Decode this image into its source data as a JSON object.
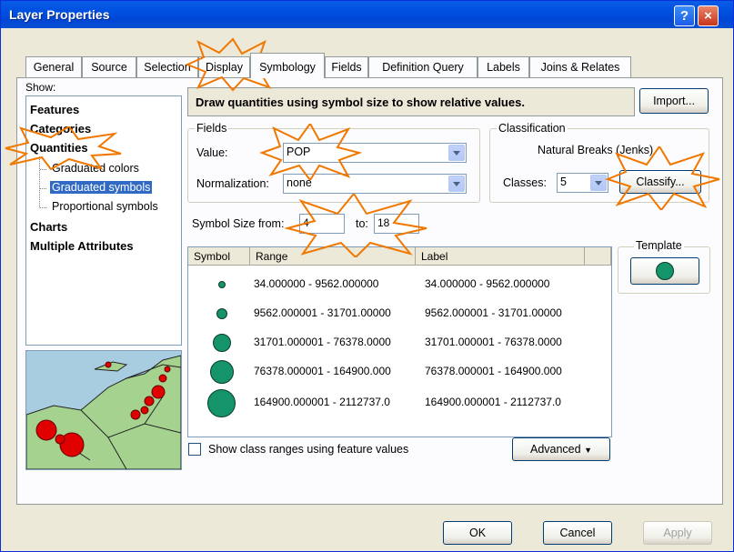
{
  "window": {
    "title": "Layer Properties",
    "help_label": "?",
    "close_label": "×"
  },
  "tabs": [
    "General",
    "Source",
    "Selection",
    "Display",
    "Symbology",
    "Fields",
    "Definition Query",
    "Labels",
    "Joins & Relates"
  ],
  "active_tab": "Symbology",
  "show": {
    "label": "Show:",
    "items": [
      "Features",
      "Categories",
      "Quantities",
      "Graduated colors",
      "Graduated symbols",
      "Proportional symbols",
      "Charts",
      "Multiple Attributes"
    ],
    "selected": "Graduated symbols"
  },
  "description": "Draw quantities using symbol size to show relative values.",
  "import_label": "Import...",
  "fields": {
    "group_label": "Fields",
    "value_label": "Value:",
    "value": "POP",
    "normalization_label": "Normalization:",
    "normalization": "none"
  },
  "classification": {
    "group_label": "Classification",
    "method": "Natural Breaks (Jenks)",
    "classes_label": "Classes:",
    "classes": "5",
    "classify_label": "Classify..."
  },
  "symbol_size": {
    "from_label": "Symbol Size from:",
    "from": "4",
    "to_label": "to:",
    "to": "18"
  },
  "table": {
    "headers": [
      "Symbol",
      "Range",
      "Label"
    ],
    "rows": [
      {
        "range": "34.000000 - 9562.000000",
        "label": "34.000000 - 9562.000000"
      },
      {
        "range": "9562.000001 - 31701.00000",
        "label": "9562.000001 - 31701.00000"
      },
      {
        "range": "31701.000001 - 76378.0000",
        "label": "31701.000001 - 76378.0000"
      },
      {
        "range": "76378.000001 - 164900.000",
        "label": "76378.000001 - 164900.000"
      },
      {
        "range": "164900.000001 - 2112737.0",
        "label": "164900.000001 - 2112737.0"
      }
    ]
  },
  "template_label": "Template",
  "show_ranges_label": "Show class ranges using feature values",
  "advanced_label": "Advanced",
  "buttons": {
    "ok": "OK",
    "cancel": "Cancel",
    "apply": "Apply"
  },
  "colors": {
    "symbol_fill": "#15936b",
    "selection": "#316ac5",
    "title_bar": "#0050e0"
  }
}
